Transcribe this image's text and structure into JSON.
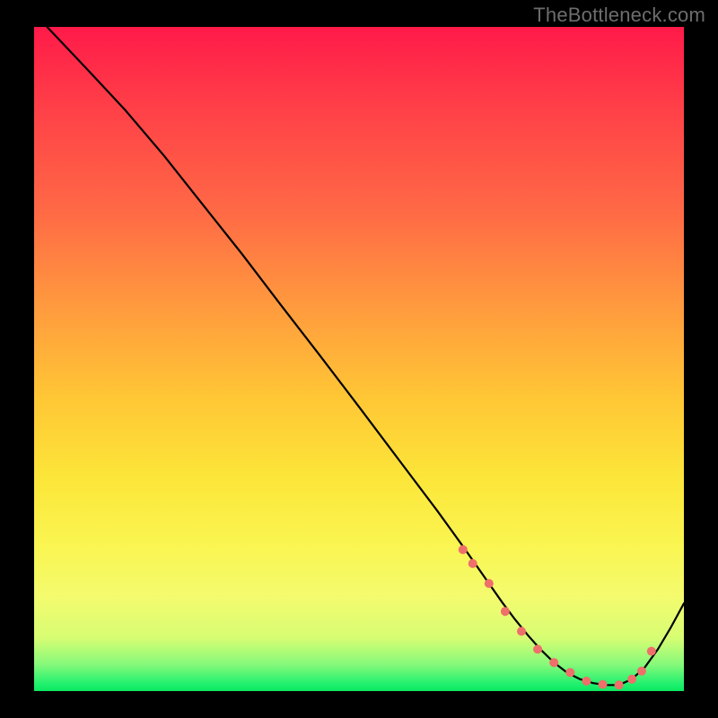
{
  "watermark": "TheBottleneck.com",
  "chart_data": {
    "type": "line",
    "title": "",
    "xlabel": "",
    "ylabel": "",
    "xlim": [
      0,
      100
    ],
    "ylim": [
      0,
      100
    ],
    "series": [
      {
        "name": "curve",
        "x": [
          2,
          8,
          14,
          20,
          26,
          32,
          38,
          44,
          50,
          56,
          62,
          66,
          70,
          72,
          74,
          76,
          78,
          80,
          82,
          84,
          86,
          88,
          90,
          92,
          94,
          96,
          98,
          100
        ],
        "values": [
          100,
          93.8,
          87.5,
          80.6,
          73.2,
          65.8,
          58.1,
          50.5,
          42.8,
          35.0,
          27.2,
          21.8,
          16.2,
          13.4,
          10.8,
          8.4,
          6.2,
          4.3,
          2.8,
          1.8,
          1.2,
          0.9,
          0.9,
          1.8,
          3.6,
          6.3,
          9.6,
          13.2
        ]
      }
    ],
    "markers": {
      "name": "highlight-dots",
      "color": "#ef6f6a",
      "x": [
        66,
        67.5,
        70,
        72.5,
        75,
        77.5,
        80,
        82.5,
        85,
        87.5,
        90,
        92,
        93.5,
        95
      ],
      "values": [
        21.3,
        19.2,
        16.2,
        12.0,
        9.0,
        6.3,
        4.3,
        2.8,
        1.5,
        1.0,
        0.9,
        1.8,
        3.0,
        6.0
      ]
    },
    "background_gradient": {
      "top": "#ff1a49",
      "mid": "#fce639",
      "bottom": "#0be85f"
    }
  }
}
